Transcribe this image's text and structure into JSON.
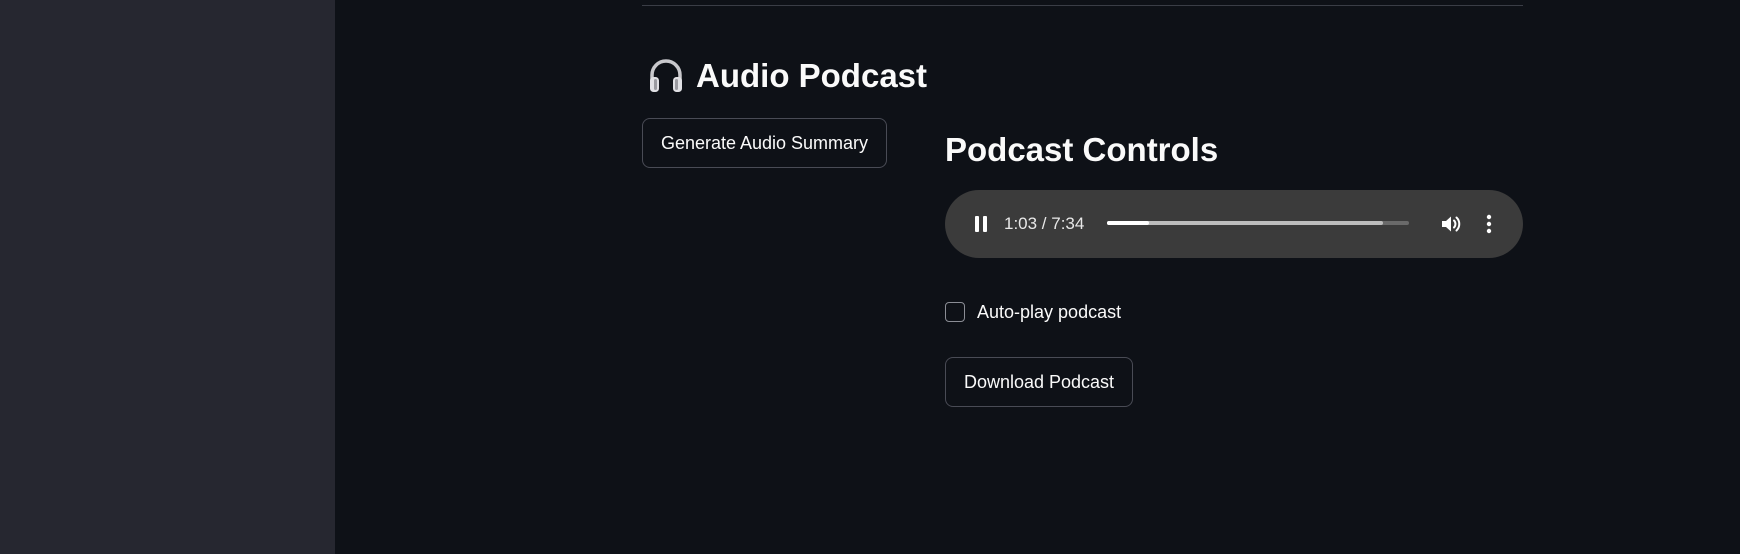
{
  "section": {
    "title": "Audio Podcast",
    "icon": "headphones-icon"
  },
  "buttons": {
    "generate_label": "Generate Audio Summary",
    "download_label": "Download Podcast"
  },
  "controls": {
    "title": "Podcast Controls"
  },
  "player": {
    "state": "playing",
    "time_display": "1:03 / 7:34",
    "played_fraction": 0.139,
    "buffered_fraction": 0.915,
    "icons": [
      "pause-icon",
      "volume-icon",
      "more-options-icon"
    ]
  },
  "autoplay": {
    "label": "Auto-play podcast",
    "checked": false
  },
  "colors": {
    "background": "#0e1117",
    "sidebar": "#262730",
    "player": "#3b3b3b",
    "text": "#fafafa",
    "button_border": "#494b55"
  }
}
